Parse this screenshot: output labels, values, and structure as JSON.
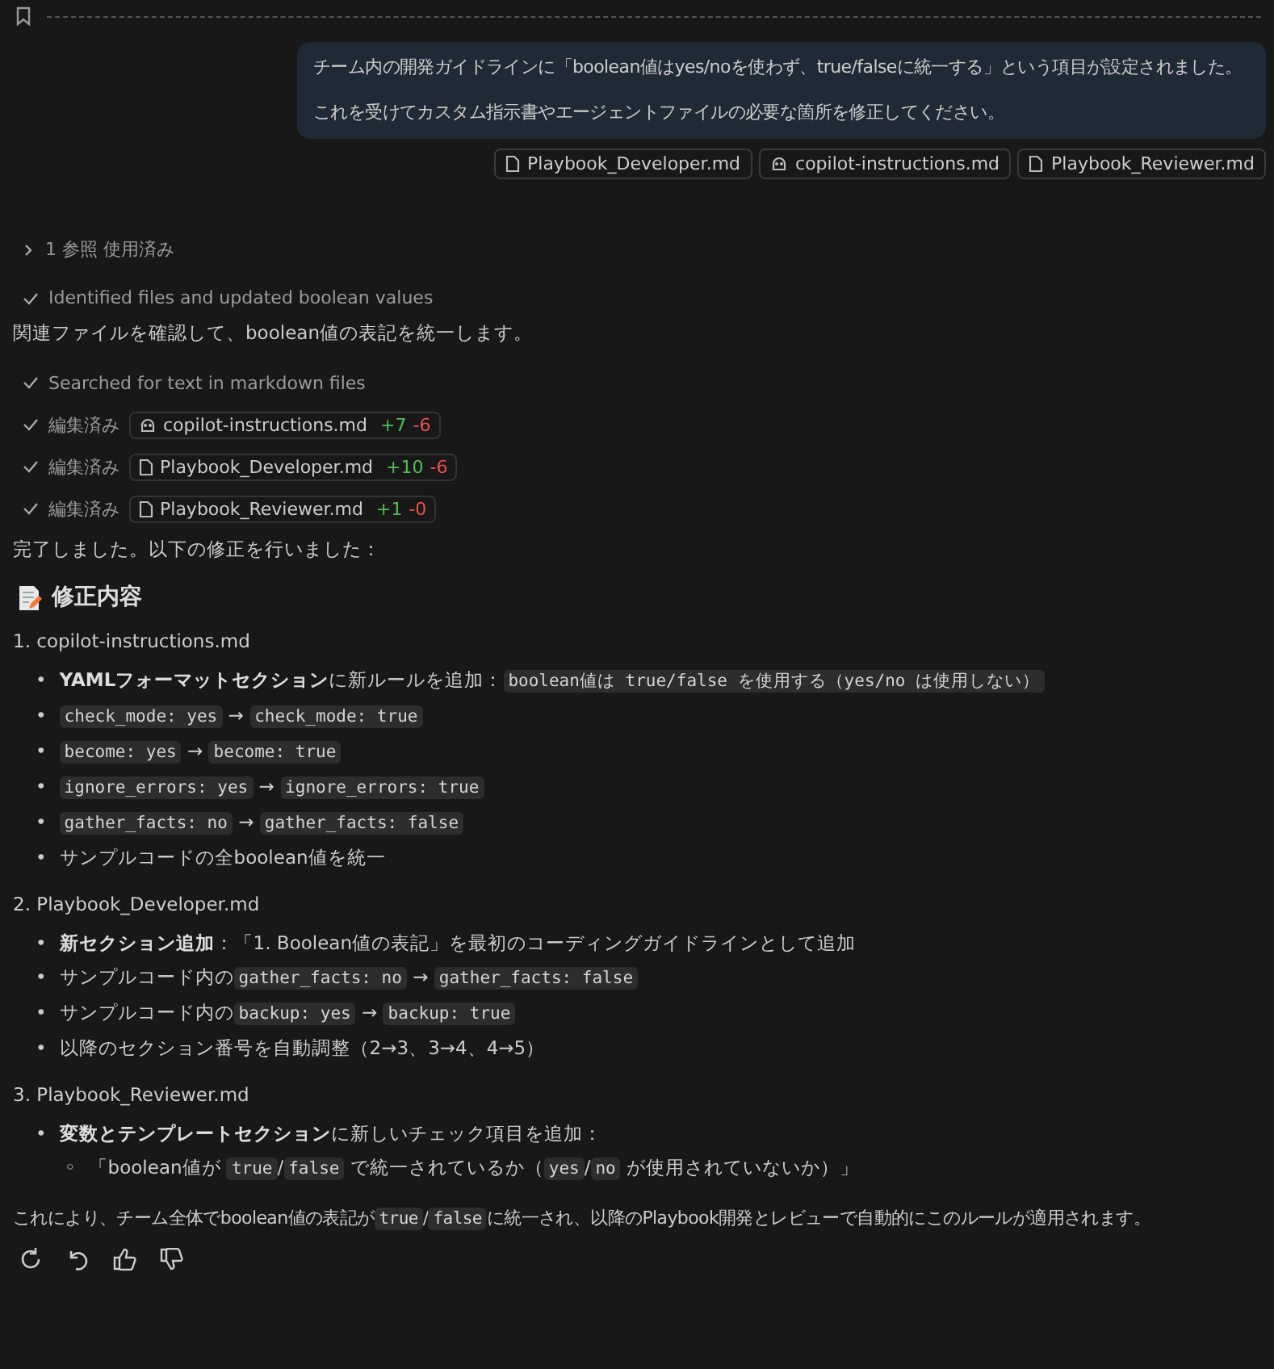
{
  "user_message": {
    "paragraphs": [
      "チーム内の開発ガイドラインに「boolean値はyes/noを使わず、true/falseに統一する」という項目が設定されました。",
      "これを受けてカスタム指示書やエージェントファイルの必要な箇所を修正してください。"
    ],
    "attachments": [
      {
        "kind": "file",
        "name": "Playbook_Developer.md"
      },
      {
        "kind": "copilot",
        "name": "copilot-instructions.md"
      },
      {
        "kind": "file",
        "name": "Playbook_Reviewer.md"
      }
    ]
  },
  "references": {
    "label": "1 参照 使用済み",
    "expanded": false
  },
  "thinking_step": "Identified files and updated boolean values",
  "intro": "関連ファイルを確認して、boolean値の表記を統一します。",
  "actions": [
    {
      "kind": "search",
      "text": "Searched for text in markdown files"
    },
    {
      "kind": "instructions_edit",
      "label": "編集済み",
      "file": "copilot-instructions.md",
      "added": "+7",
      "removed": "-6"
    },
    {
      "kind": "file_edit",
      "label": "編集済み",
      "file": "Playbook_Developer.md",
      "added": "+10",
      "removed": "-6"
    },
    {
      "kind": "file_edit",
      "label": "編集済み",
      "file": "Playbook_Reviewer.md",
      "added": "+1",
      "removed": "-0"
    }
  ],
  "summary_lead": "完了しました。以下の修正を行いました：",
  "heading": "修正内容",
  "sections": [
    {
      "title": "1. copilot-instructions.md",
      "bullets": [
        {
          "marker": "•",
          "segments": [
            {
              "kind": "bold",
              "text": "YAMLフォーマットセクション"
            },
            {
              "kind": "text",
              "text": "に新ルールを追加："
            },
            {
              "kind": "code",
              "text": "boolean値は true/false を使用する（yes/no は使用しない）"
            }
          ]
        },
        {
          "marker": "•",
          "segments": [
            {
              "kind": "code",
              "text": "check_mode: yes"
            },
            {
              "kind": "text",
              "text": " → "
            },
            {
              "kind": "code",
              "text": "check_mode: true"
            }
          ]
        },
        {
          "marker": "•",
          "segments": [
            {
              "kind": "code",
              "text": "become: yes"
            },
            {
              "kind": "text",
              "text": " → "
            },
            {
              "kind": "code",
              "text": "become: true"
            }
          ]
        },
        {
          "marker": "•",
          "segments": [
            {
              "kind": "code",
              "text": "ignore_errors: yes"
            },
            {
              "kind": "text",
              "text": " → "
            },
            {
              "kind": "code",
              "text": "ignore_errors: true"
            }
          ]
        },
        {
          "marker": "•",
          "segments": [
            {
              "kind": "code",
              "text": "gather_facts: no"
            },
            {
              "kind": "text",
              "text": " → "
            },
            {
              "kind": "code",
              "text": "gather_facts: false"
            }
          ]
        },
        {
          "marker": "•",
          "segments": [
            {
              "kind": "text",
              "text": "サンプルコードの全boolean値を統一"
            }
          ]
        }
      ]
    },
    {
      "title": "2. Playbook_Developer.md",
      "bullets": [
        {
          "marker": "•",
          "segments": [
            {
              "kind": "bold",
              "text": "新セクション追加"
            },
            {
              "kind": "text",
              "text": "：「1. Boolean値の表記」を最初のコーディングガイドラインとして追加"
            }
          ]
        },
        {
          "marker": "•",
          "segments": [
            {
              "kind": "text",
              "text": "サンプルコード内の"
            },
            {
              "kind": "code",
              "text": "gather_facts: no"
            },
            {
              "kind": "text",
              "text": " → "
            },
            {
              "kind": "code",
              "text": "gather_facts: false"
            }
          ]
        },
        {
          "marker": "•",
          "segments": [
            {
              "kind": "text",
              "text": "サンプルコード内の"
            },
            {
              "kind": "code",
              "text": "backup: yes"
            },
            {
              "kind": "text",
              "text": " → "
            },
            {
              "kind": "code",
              "text": "backup: true"
            }
          ]
        },
        {
          "marker": "•",
          "segments": [
            {
              "kind": "text",
              "text": "以降のセクション番号を自動調整（2→3、3→4、4→5）"
            }
          ]
        }
      ]
    },
    {
      "title": "3. Playbook_Reviewer.md",
      "bullets": [
        {
          "marker": "•",
          "segments": [
            {
              "kind": "bold",
              "text": "変数とテンプレートセクション"
            },
            {
              "kind": "text",
              "text": "に新しいチェック項目を追加："
            }
          ],
          "children": [
            {
              "marker": "◦",
              "segments": [
                {
                  "kind": "text",
                  "text": "「boolean値が "
                },
                {
                  "kind": "code",
                  "text": "true"
                },
                {
                  "kind": "text",
                  "text": "/"
                },
                {
                  "kind": "code",
                  "text": "false"
                },
                {
                  "kind": "text",
                  "text": " で統一されているか（"
                },
                {
                  "kind": "code",
                  "text": "yes"
                },
                {
                  "kind": "text",
                  "text": "/"
                },
                {
                  "kind": "code",
                  "text": "no"
                },
                {
                  "kind": "text",
                  "text": " が使用されていないか）」"
                }
              ]
            }
          ]
        }
      ]
    }
  ],
  "conclusion": [
    {
      "kind": "text",
      "text": "これにより、チーム全体でboolean値の表記が"
    },
    {
      "kind": "code",
      "text": "true"
    },
    {
      "kind": "text",
      "text": "/"
    },
    {
      "kind": "code",
      "text": "false"
    },
    {
      "kind": "text",
      "text": "に統一され、以降のPlaybook開発とレビューで自動的にこのルールが適用されます。"
    }
  ]
}
